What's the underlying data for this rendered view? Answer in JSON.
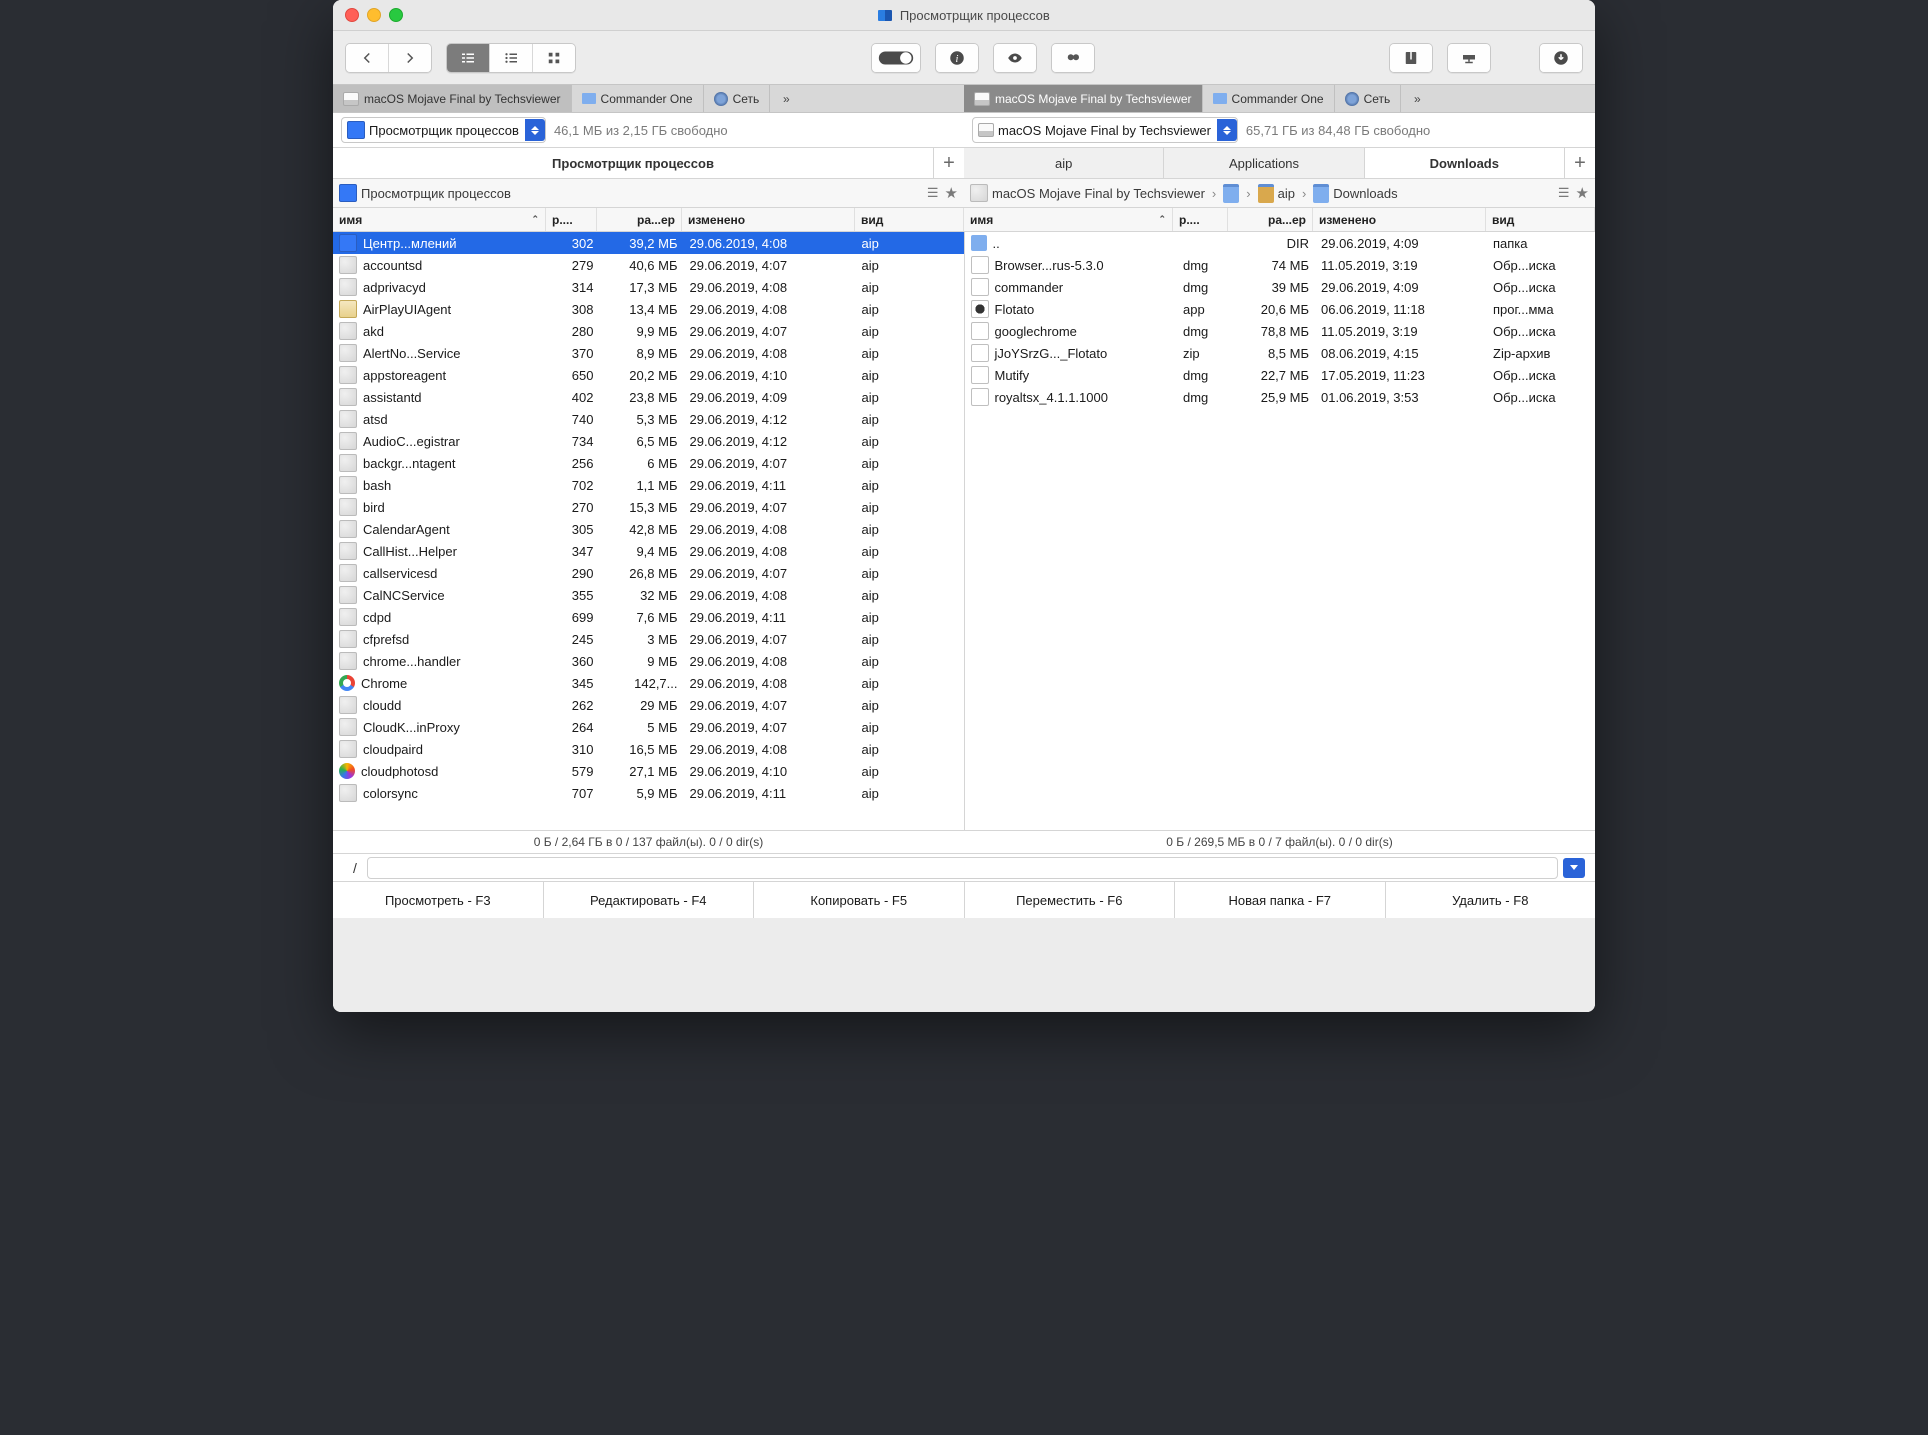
{
  "window": {
    "title": "Просмотрщик процессов"
  },
  "toolbar": {},
  "tabs": {
    "left": [
      {
        "label": "macOS Mojave Final by Techsviewer",
        "icon": "drive",
        "active": true
      },
      {
        "label": "Commander One",
        "icon": "folder"
      },
      {
        "label": "Сеть",
        "icon": "globe"
      }
    ],
    "right": [
      {
        "label": "macOS Mojave Final by Techsviewer",
        "icon": "drive",
        "active": true,
        "highlight": true
      },
      {
        "label": "Commander One",
        "icon": "folder"
      },
      {
        "label": "Сеть",
        "icon": "globe"
      }
    ]
  },
  "location": {
    "left": {
      "label": "Просмотрщик процессов",
      "free": "46,1 МБ из 2,15 ГБ свободно"
    },
    "right": {
      "label": "macOS Mojave Final by Techsviewer",
      "free": "65,71 ГБ из 84,48 ГБ свободно"
    }
  },
  "coltabs": {
    "left": [
      {
        "label": "Просмотрщик процессов",
        "active": true
      }
    ],
    "right": [
      {
        "label": "aip"
      },
      {
        "label": "Applications"
      },
      {
        "label": "Downloads",
        "active": true
      }
    ]
  },
  "crumbs": {
    "left": {
      "items": [
        {
          "label": "Просмотрщик процессов",
          "icon": "monitor"
        }
      ]
    },
    "right": {
      "items": [
        {
          "label": "macOS Mojave Final by Techsviewer",
          "icon": "drive"
        },
        {
          "label": "",
          "icon": "folder"
        },
        {
          "label": "aip",
          "icon": "home"
        },
        {
          "label": "Downloads",
          "icon": "folder"
        }
      ]
    }
  },
  "headers": {
    "left": [
      {
        "key": "name",
        "label": "имя",
        "sort": true
      },
      {
        "key": "pid",
        "label": "р...."
      },
      {
        "key": "size",
        "label": "ра...ер"
      },
      {
        "key": "date",
        "label": "изменено"
      },
      {
        "key": "kind",
        "label": "вид"
      }
    ],
    "right": [
      {
        "key": "name",
        "label": "имя",
        "sort": true
      },
      {
        "key": "ext",
        "label": "р...."
      },
      {
        "key": "size",
        "label": "ра...ер"
      },
      {
        "key": "date",
        "label": "изменено"
      },
      {
        "key": "kind",
        "label": "вид"
      }
    ]
  },
  "rows": {
    "left": [
      {
        "icon": "monitor",
        "name": "Центр...млений",
        "pid": "302",
        "size": "39,2 МБ",
        "date": "29.06.2019, 4:08",
        "kind": "aip",
        "selected": true
      },
      {
        "icon": "generic",
        "name": "accountsd",
        "pid": "279",
        "size": "40,6 МБ",
        "date": "29.06.2019, 4:07",
        "kind": "aip"
      },
      {
        "icon": "generic",
        "name": "adprivacyd",
        "pid": "314",
        "size": "17,3 МБ",
        "date": "29.06.2019, 4:08",
        "kind": "aip"
      },
      {
        "icon": "airplay",
        "name": "AirPlayUIAgent",
        "pid": "308",
        "size": "13,4 МБ",
        "date": "29.06.2019, 4:08",
        "kind": "aip"
      },
      {
        "icon": "generic",
        "name": "akd",
        "pid": "280",
        "size": "9,9 МБ",
        "date": "29.06.2019, 4:07",
        "kind": "aip"
      },
      {
        "icon": "generic",
        "name": "AlertNo...Service",
        "pid": "370",
        "size": "8,9 МБ",
        "date": "29.06.2019, 4:08",
        "kind": "aip"
      },
      {
        "icon": "generic",
        "name": "appstoreagent",
        "pid": "650",
        "size": "20,2 МБ",
        "date": "29.06.2019, 4:10",
        "kind": "aip"
      },
      {
        "icon": "generic",
        "name": "assistantd",
        "pid": "402",
        "size": "23,8 МБ",
        "date": "29.06.2019, 4:09",
        "kind": "aip"
      },
      {
        "icon": "generic",
        "name": "atsd",
        "pid": "740",
        "size": "5,3 МБ",
        "date": "29.06.2019, 4:12",
        "kind": "aip"
      },
      {
        "icon": "generic",
        "name": "AudioC...egistrar",
        "pid": "734",
        "size": "6,5 МБ",
        "date": "29.06.2019, 4:12",
        "kind": "aip"
      },
      {
        "icon": "generic",
        "name": "backgr...ntagent",
        "pid": "256",
        "size": "6 МБ",
        "date": "29.06.2019, 4:07",
        "kind": "aip"
      },
      {
        "icon": "generic",
        "name": "bash",
        "pid": "702",
        "size": "1,1 МБ",
        "date": "29.06.2019, 4:11",
        "kind": "aip"
      },
      {
        "icon": "generic",
        "name": "bird",
        "pid": "270",
        "size": "15,3 МБ",
        "date": "29.06.2019, 4:07",
        "kind": "aip"
      },
      {
        "icon": "generic",
        "name": "CalendarAgent",
        "pid": "305",
        "size": "42,8 МБ",
        "date": "29.06.2019, 4:08",
        "kind": "aip"
      },
      {
        "icon": "generic",
        "name": "CallHist...Helper",
        "pid": "347",
        "size": "9,4 МБ",
        "date": "29.06.2019, 4:08",
        "kind": "aip"
      },
      {
        "icon": "generic",
        "name": "callservicesd",
        "pid": "290",
        "size": "26,8 МБ",
        "date": "29.06.2019, 4:07",
        "kind": "aip"
      },
      {
        "icon": "generic",
        "name": "CalNCService",
        "pid": "355",
        "size": "32 МБ",
        "date": "29.06.2019, 4:08",
        "kind": "aip"
      },
      {
        "icon": "generic",
        "name": "cdpd",
        "pid": "699",
        "size": "7,6 МБ",
        "date": "29.06.2019, 4:11",
        "kind": "aip"
      },
      {
        "icon": "generic",
        "name": "cfprefsd",
        "pid": "245",
        "size": "3 МБ",
        "date": "29.06.2019, 4:07",
        "kind": "aip"
      },
      {
        "icon": "generic",
        "name": "chrome...handler",
        "pid": "360",
        "size": "9 МБ",
        "date": "29.06.2019, 4:08",
        "kind": "aip"
      },
      {
        "icon": "chrome",
        "name": "Chrome",
        "pid": "345",
        "size": "142,7...",
        "date": "29.06.2019, 4:08",
        "kind": "aip"
      },
      {
        "icon": "generic",
        "name": "cloudd",
        "pid": "262",
        "size": "29 МБ",
        "date": "29.06.2019, 4:07",
        "kind": "aip"
      },
      {
        "icon": "generic",
        "name": "CloudK...inProxy",
        "pid": "264",
        "size": "5 МБ",
        "date": "29.06.2019, 4:07",
        "kind": "aip"
      },
      {
        "icon": "generic",
        "name": "cloudpaird",
        "pid": "310",
        "size": "16,5 МБ",
        "date": "29.06.2019, 4:08",
        "kind": "aip"
      },
      {
        "icon": "photo",
        "name": "cloudphotosd",
        "pid": "579",
        "size": "27,1 МБ",
        "date": "29.06.2019, 4:10",
        "kind": "aip"
      },
      {
        "icon": "generic",
        "name": "colorsync",
        "pid": "707",
        "size": "5,9 МБ",
        "date": "29.06.2019, 4:11",
        "kind": "aip"
      }
    ],
    "right": [
      {
        "icon": "back",
        "name": "..",
        "ext": "",
        "size": "DIR",
        "date": "29.06.2019, 4:09",
        "kind": "папка"
      },
      {
        "icon": "dmg",
        "name": "Browser...rus-5.3.0",
        "ext": "dmg",
        "size": "74 МБ",
        "date": "11.05.2019, 3:19",
        "kind": "Обр...иска"
      },
      {
        "icon": "dmg",
        "name": "commander",
        "ext": "dmg",
        "size": "39 МБ",
        "date": "29.06.2019, 4:09",
        "kind": "Обр...иска"
      },
      {
        "icon": "gear",
        "name": "Flotato",
        "ext": "app",
        "size": "20,6 МБ",
        "date": "06.06.2019, 11:18",
        "kind": "прог...мма"
      },
      {
        "icon": "dmg",
        "name": "googlechrome",
        "ext": "dmg",
        "size": "78,8 МБ",
        "date": "11.05.2019, 3:19",
        "kind": "Обр...иска"
      },
      {
        "icon": "zip",
        "name": "jJoYSrzG..._Flotato",
        "ext": "zip",
        "size": "8,5 МБ",
        "date": "08.06.2019, 4:15",
        "kind": "Zip-архив"
      },
      {
        "icon": "dmg",
        "name": "Mutify",
        "ext": "dmg",
        "size": "22,7 МБ",
        "date": "17.05.2019, 11:23",
        "kind": "Обр...иска"
      },
      {
        "icon": "dmg",
        "name": "royaltsx_4.1.1.1000",
        "ext": "dmg",
        "size": "25,9 МБ",
        "date": "01.06.2019, 3:53",
        "kind": "Обр...иска"
      }
    ]
  },
  "status": {
    "left": "0 Б / 2,64 ГБ в 0 / 137 файл(ы). 0 / 0 dir(s)",
    "right": "0 Б / 269,5 МБ в 0 / 7 файл(ы). 0 / 0 dir(s)"
  },
  "cmdline": {
    "label": "/"
  },
  "fn": [
    "Просмотреть - F3",
    "Редактировать - F4",
    "Копировать - F5",
    "Переместить - F6",
    "Новая папка - F7",
    "Удалить - F8"
  ]
}
